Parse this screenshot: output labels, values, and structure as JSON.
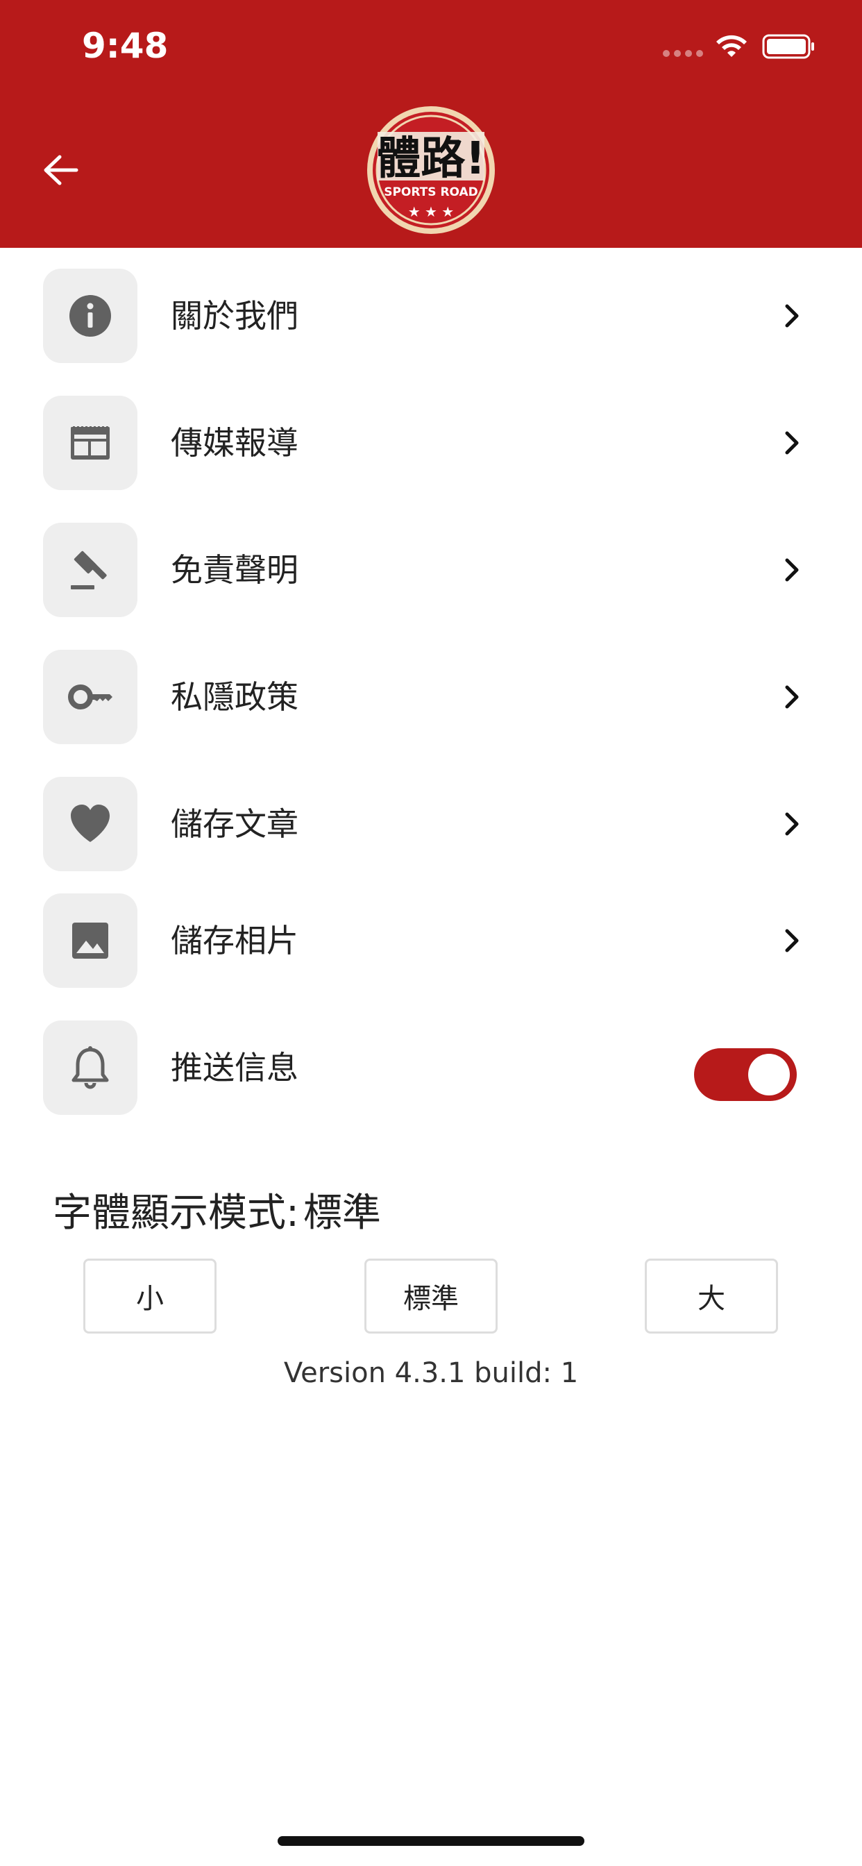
{
  "status_bar": {
    "time": "9:48"
  },
  "header": {
    "back_icon": "arrow-left-icon",
    "logo_text": "體路!",
    "logo_subtitle": "SPORTS ROAD",
    "brand_color": "#b71a1a"
  },
  "menu": {
    "items": [
      {
        "label": "關於我們",
        "icon": "info-icon"
      },
      {
        "label": "傳媒報導",
        "icon": "newspaper-icon"
      },
      {
        "label": "免責聲明",
        "icon": "gavel-icon"
      },
      {
        "label": "私隱政策",
        "icon": "key-icon"
      },
      {
        "label": "儲存文章",
        "icon": "heart-icon"
      },
      {
        "label": "儲存相片",
        "icon": "image-icon"
      },
      {
        "label": "推送信息",
        "icon": "bell-icon",
        "toggle_on": true
      }
    ]
  },
  "font_mode": {
    "label": "字體顯示模式:",
    "current": "標準",
    "options": [
      "小",
      "標準",
      "大"
    ]
  },
  "version": "Version 4.3.1 build: 1"
}
